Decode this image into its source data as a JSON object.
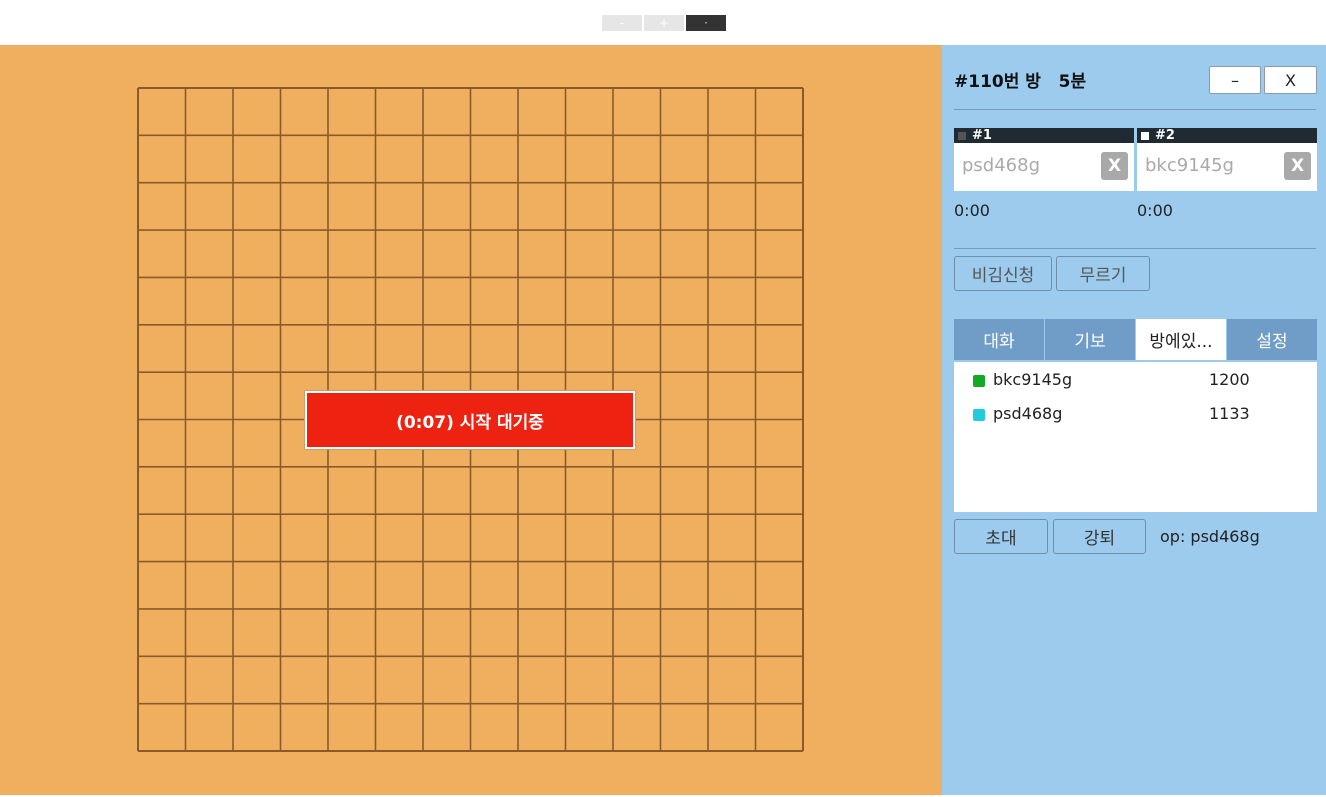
{
  "zoom": {
    "minus_label": "-",
    "plus_label": "+",
    "reset_label": "·"
  },
  "board": {
    "size": 15,
    "line_color": "#8b5a2b",
    "background": "#f0af5f"
  },
  "overlay": {
    "text": "(0:07) 시작 대기중",
    "color": "#ee2211"
  },
  "room": {
    "title": "#110번 방   5분",
    "minimize_label": "–",
    "close_label": "X"
  },
  "players": [
    {
      "slot_label": "#1",
      "slot_color": "#555555",
      "name": "psd468g",
      "kick_label": "X",
      "timer": "0:00"
    },
    {
      "slot_label": "#2",
      "slot_color": "#ffffff",
      "name": "bkc9145g",
      "kick_label": "X",
      "timer": "0:00"
    }
  ],
  "actions": {
    "draw_label": "비김신청",
    "undo_label": "무르기"
  },
  "tabs": [
    {
      "label": "대화",
      "active": false
    },
    {
      "label": "기보",
      "active": false
    },
    {
      "label": "방에있...",
      "active": true
    },
    {
      "label": "설정",
      "active": false
    }
  ],
  "users": [
    {
      "name": "bkc9145g",
      "score": "1200",
      "color": "#11aa22"
    },
    {
      "name": "psd468g",
      "score": "1133",
      "color": "#22ccdd"
    }
  ],
  "bottom": {
    "invite_label": "초대",
    "kick_label": "강퇴",
    "op_text": "op: psd468g"
  }
}
